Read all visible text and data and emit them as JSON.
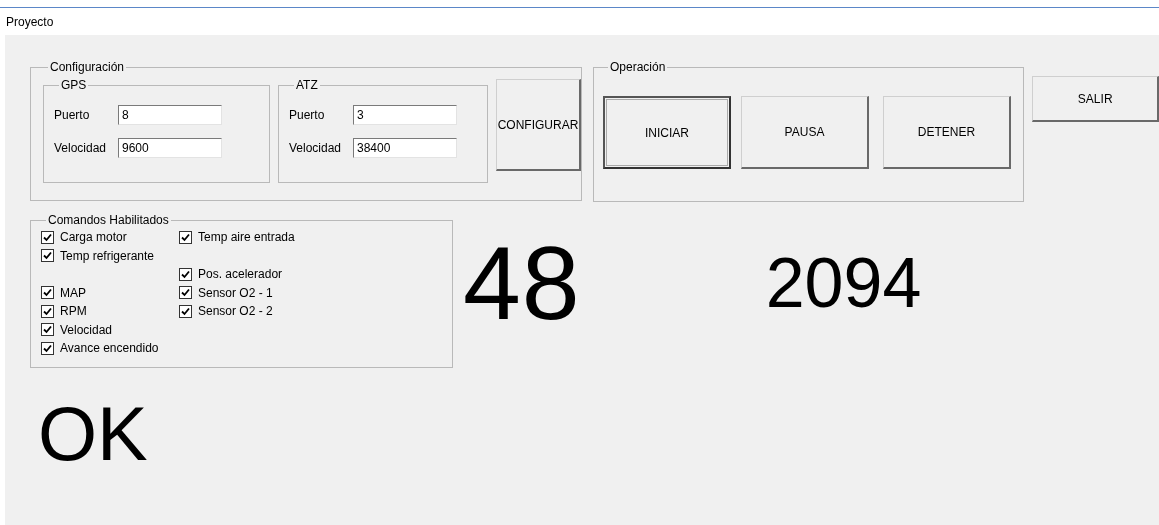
{
  "window": {
    "title": "Proyecto"
  },
  "configuracion": {
    "title": "Configuración",
    "groups": [
      {
        "title": "GPS",
        "fields": [
          {
            "label": "Puerto",
            "value": "8"
          },
          {
            "label": "Velocidad",
            "value": "9600"
          }
        ]
      },
      {
        "title": "ATZ",
        "fields": [
          {
            "label": "Puerto",
            "value": "3"
          },
          {
            "label": "Velocidad",
            "value": "38400"
          }
        ]
      }
    ],
    "button": "CONFIGURAR"
  },
  "operacion": {
    "title": "Operación",
    "buttons": [
      {
        "label": "INICIAR",
        "focused": true
      },
      {
        "label": "PAUSA",
        "focused": false
      },
      {
        "label": "DETENER",
        "focused": false
      }
    ]
  },
  "exit_button": "SALIR",
  "comandos": {
    "title": "Comandos Habilitados",
    "items": [
      {
        "label": "Carga motor",
        "checked": true
      },
      {
        "label": "Temp refrigerante",
        "checked": true
      },
      {
        "label": "MAP",
        "checked": true
      },
      {
        "label": "RPM",
        "checked": true
      },
      {
        "label": "Velocidad",
        "checked": true
      },
      {
        "label": "Avance encendido",
        "checked": true
      },
      {
        "label": "Temp aire entrada",
        "checked": true
      },
      {
        "label": "Pos. acelerador",
        "checked": true
      },
      {
        "label": "Sensor O2 - 1",
        "checked": true
      },
      {
        "label": "Sensor O2 - 2",
        "checked": true
      }
    ]
  },
  "readouts": [
    "48",
    "2094"
  ],
  "status": "OK"
}
